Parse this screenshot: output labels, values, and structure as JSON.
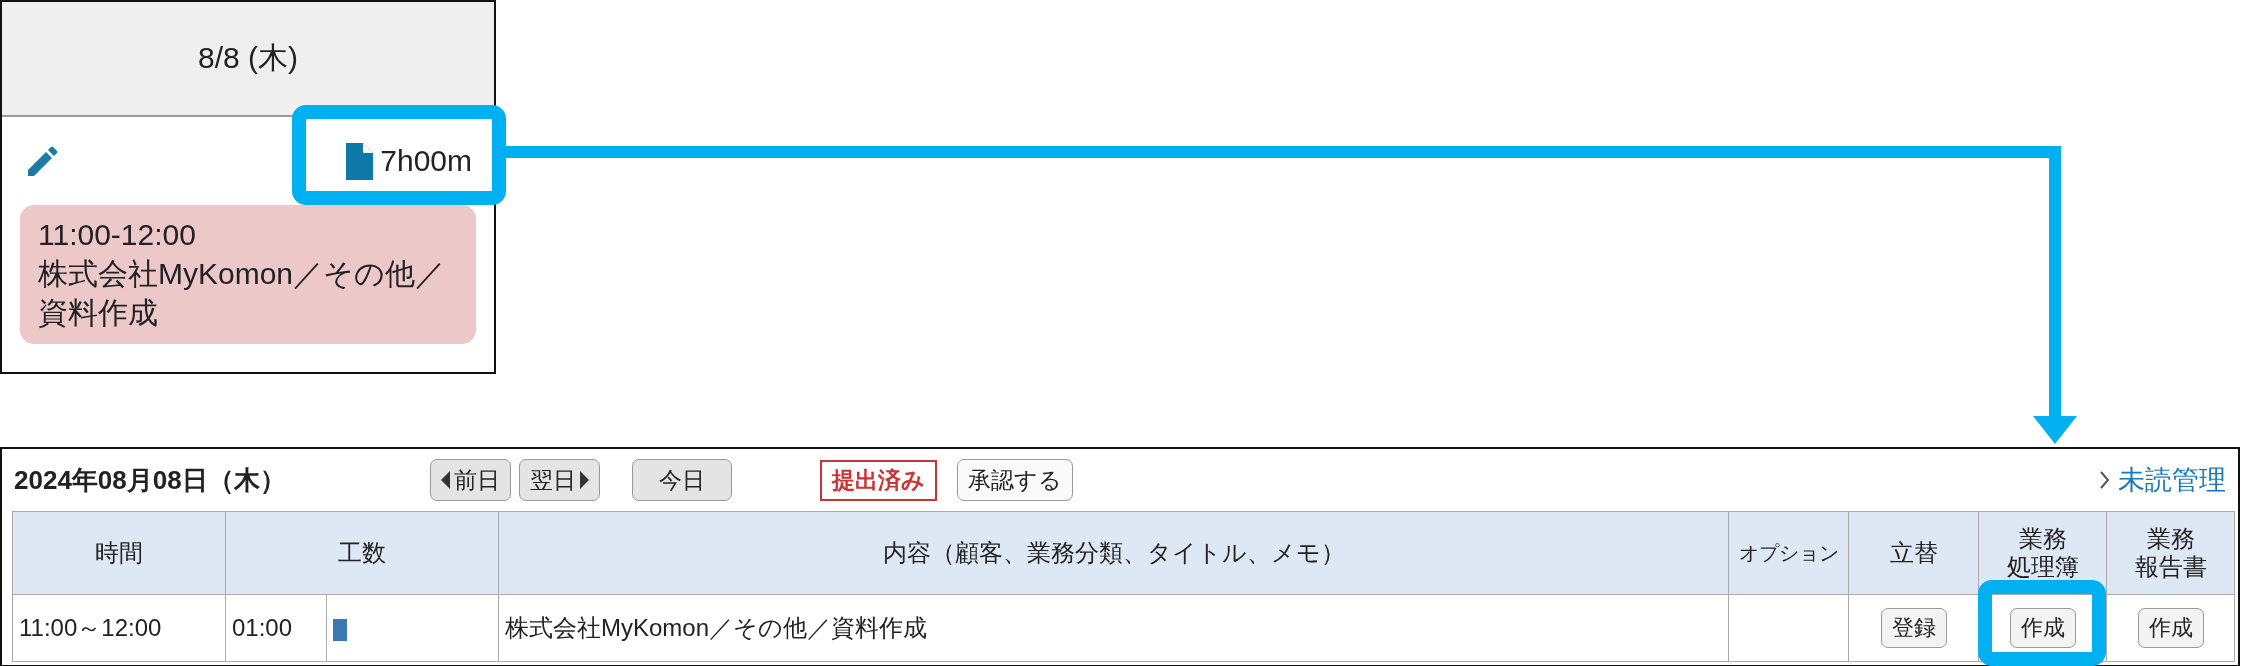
{
  "day_card": {
    "date": "8/8 (木)",
    "total": "7h00m",
    "events": [
      {
        "time": "11:00-12:00",
        "text": "株式会社MyKomon／その他／資料作成"
      }
    ]
  },
  "daily_report": {
    "date": "2024年08月08日（木）",
    "nav_buttons": [
      {
        "label": "前日",
        "kind": "prev"
      },
      {
        "label": "翌日",
        "kind": "next"
      },
      {
        "label": "今日",
        "kind": "today"
      }
    ],
    "status_badge": "提出済み",
    "approve_button": "承認する",
    "unread_link": "未読管理",
    "table": {
      "columns": [
        "時間",
        "工数",
        "内容（顧客、業務分類、タイトル、メモ）",
        "オプション",
        "立替",
        "業務処理簿",
        "業務報告書"
      ],
      "rows": [
        {
          "time": "11:00～12:00",
          "hours": "01:00",
          "color": "#3d78b4",
          "content": "株式会社MyKomon／その他／資料作成",
          "advance_button": "登録",
          "ledger_button": "作成",
          "report_button": "作成"
        }
      ]
    }
  }
}
